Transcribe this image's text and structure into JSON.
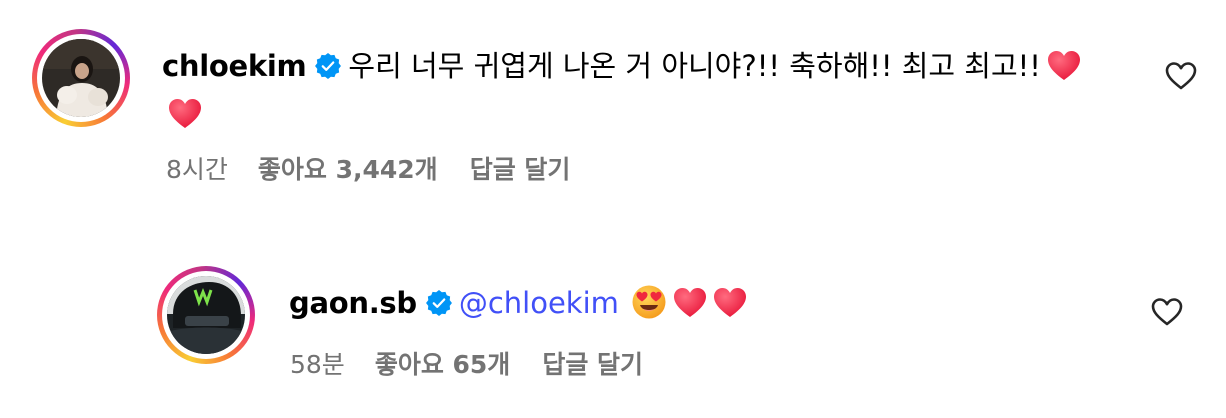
{
  "comments": [
    {
      "username": "chloekim",
      "verified": true,
      "text": "우리 너무 귀엽게 나온 거 아니야?!! 축하해!! 최고 최고!!",
      "emojis": [
        "red-heart",
        "red-heart"
      ],
      "time": "8시간",
      "likes": "좋아요 3,442개",
      "reply": "답글 달기"
    },
    {
      "username": "gaon.sb",
      "verified": true,
      "mention": "@chloekim",
      "emojis": [
        "heart-eyes",
        "red-heart",
        "red-heart"
      ],
      "time": "58분",
      "likes": "좋아요 65개",
      "reply": "답글 달기"
    }
  ],
  "colors": {
    "verified": "#0095f6",
    "mention": "#4150f7",
    "meta": "#737373",
    "heart": "#ff3040"
  }
}
